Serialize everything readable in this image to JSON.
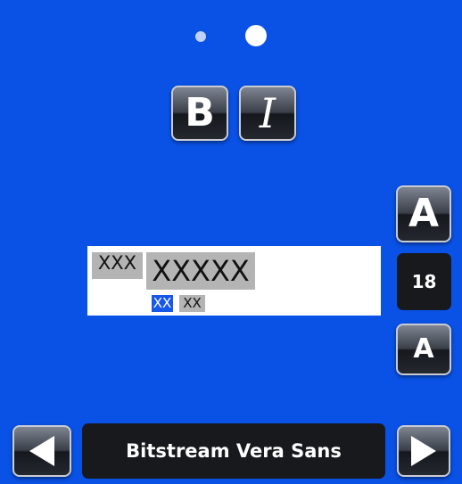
{
  "page_indicator": {
    "pages": 2,
    "active_page": 2
  },
  "style_buttons": {
    "bold_label": "B",
    "italic_label": "I"
  },
  "size_controls": {
    "increase_label": "A",
    "decrease_label": "A",
    "current_size": "18"
  },
  "preview": {
    "sample_small": "XXX",
    "sample_large": "XXXXX",
    "sample_selected": "XX",
    "sample_tiny": "XX"
  },
  "font_selector": {
    "current_font": "Bitstream Vera Sans",
    "prev_icon": "triangle-left-icon",
    "next_icon": "triangle-right-icon"
  },
  "colors": {
    "background": "#0a52e6",
    "button_dark": "#17191c",
    "glyph_highlight": "#b4b4b4",
    "selection": "#1858e8"
  }
}
